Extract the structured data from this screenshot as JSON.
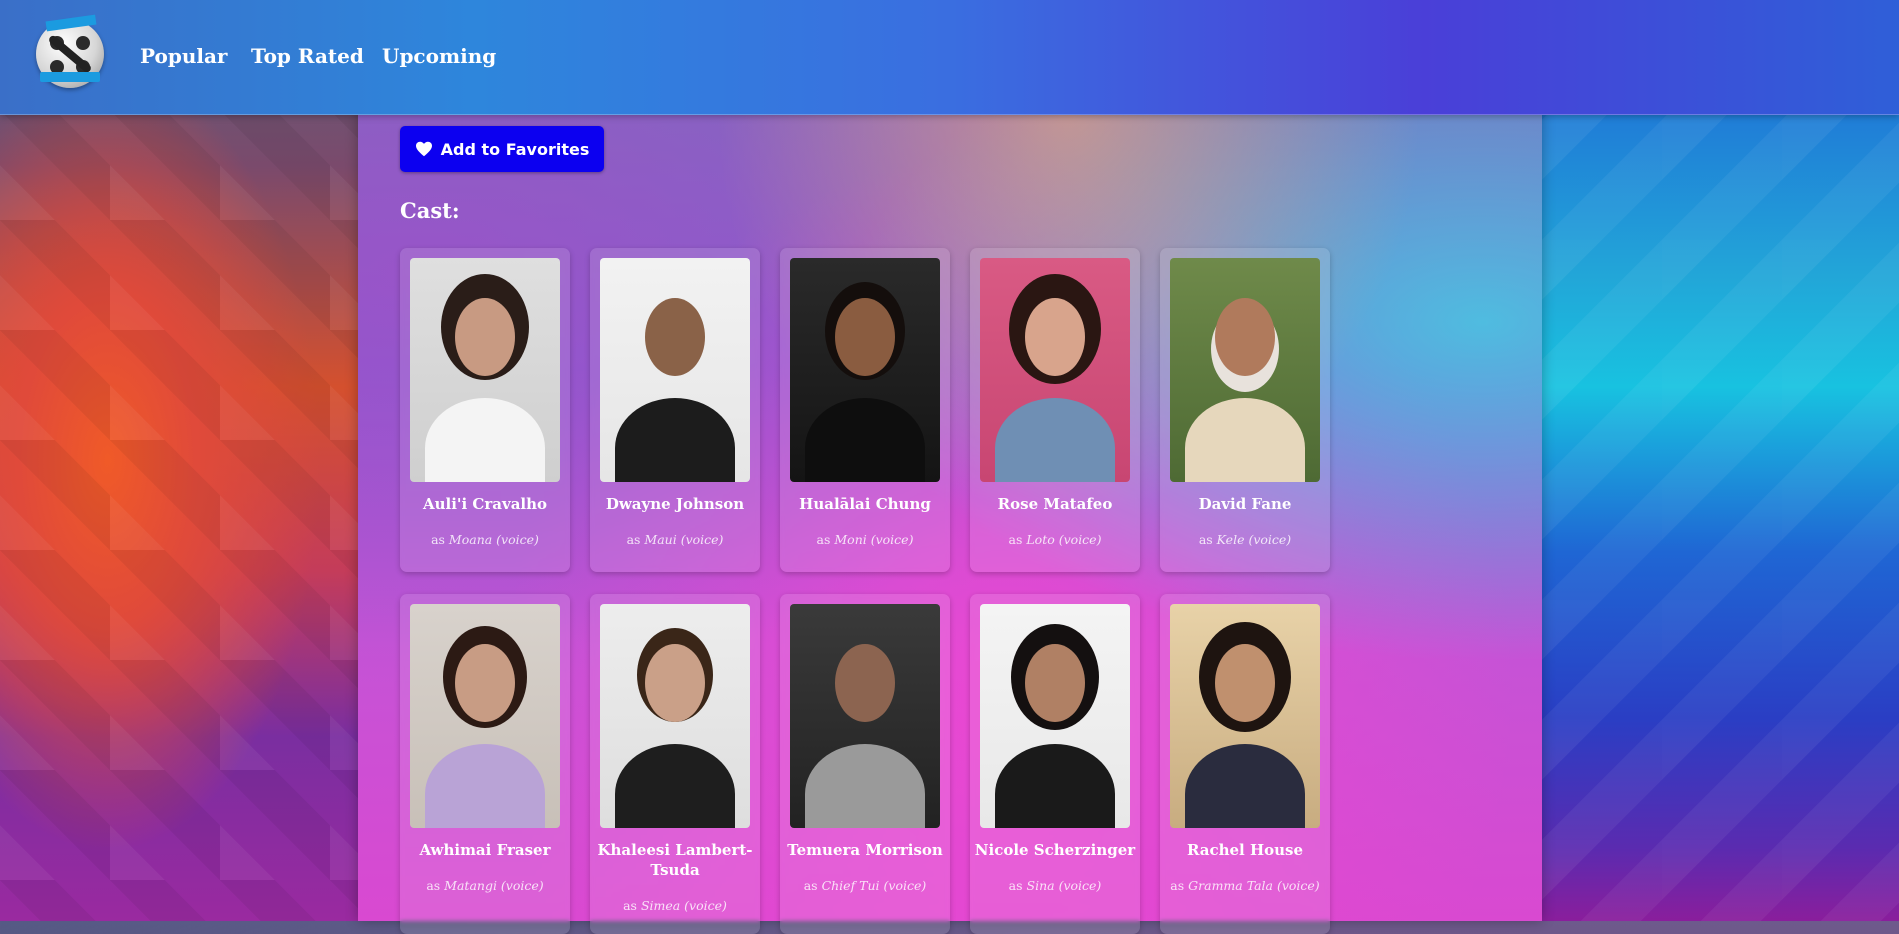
{
  "nav": {
    "links": [
      {
        "label": "Popular"
      },
      {
        "label": "Top Rated"
      },
      {
        "label": "Upcoming"
      }
    ]
  },
  "favorites_button": {
    "label": "Add to Favorites",
    "icon": "heart-icon"
  },
  "cast_heading": "Cast:",
  "cast": [
    {
      "name": "Auli'i Cravalho",
      "role_prefix": "as",
      "character": "Moana (voice)"
    },
    {
      "name": "Dwayne Johnson",
      "role_prefix": "as",
      "character": "Maui (voice)"
    },
    {
      "name": "Hualālai Chung",
      "role_prefix": "as",
      "character": "Moni (voice)"
    },
    {
      "name": "Rose Matafeo",
      "role_prefix": "as",
      "character": "Loto (voice)"
    },
    {
      "name": "David Fane",
      "role_prefix": "as",
      "character": "Kele (voice)"
    },
    {
      "name": "Awhimai Fraser",
      "role_prefix": "as",
      "character": "Matangi (voice)"
    },
    {
      "name": "Khaleesi Lambert-Tsuda",
      "role_prefix": "as",
      "character": "Simea (voice)"
    },
    {
      "name": "Temuera Morrison",
      "role_prefix": "as",
      "character": "Chief Tui (voice)"
    },
    {
      "name": "Nicole Scherzinger",
      "role_prefix": "as",
      "character": "Sina (voice)"
    },
    {
      "name": "Rachel House",
      "role_prefix": "as",
      "character": "Gramma Tala (voice)"
    }
  ],
  "colors": {
    "button": "#0c00f0",
    "text": "#ffffff"
  }
}
